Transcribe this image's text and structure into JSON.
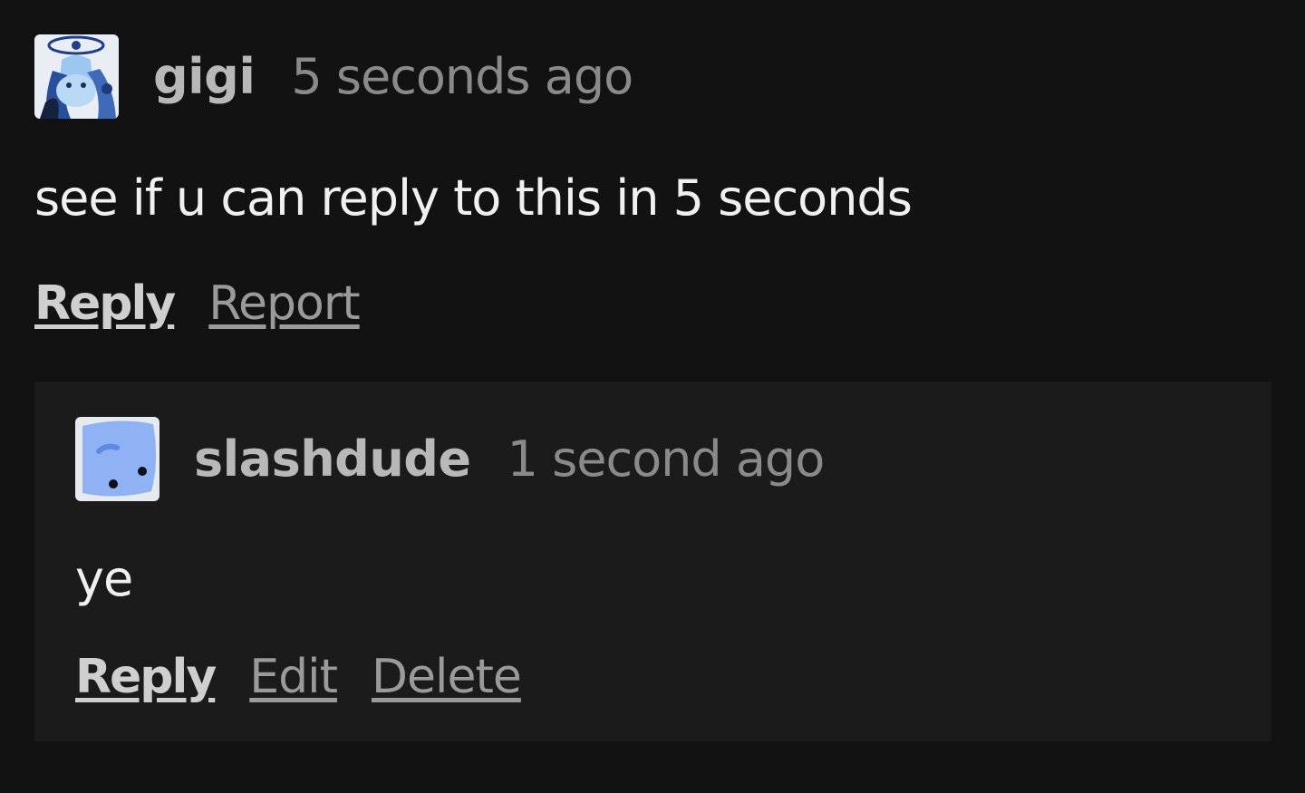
{
  "comment": {
    "username": "gigi",
    "timestamp": "5 seconds ago",
    "avatar_icon": "anime-character-avatar-icon",
    "body": "see if u can reply to this in 5 seconds",
    "actions": {
      "reply": "Reply",
      "report": "Report"
    }
  },
  "reply": {
    "username": "slashdude",
    "timestamp": "1 second ago",
    "avatar_icon": "blue-blob-avatar-icon",
    "body": "ye",
    "actions": {
      "reply": "Reply",
      "edit": "Edit",
      "delete": "Delete"
    }
  },
  "colors": {
    "background": "#121212",
    "reply_background": "#1b1b1b",
    "username": "#b8b8b8",
    "timestamp": "#8a8a8a",
    "body_text": "#f0f0f0"
  }
}
